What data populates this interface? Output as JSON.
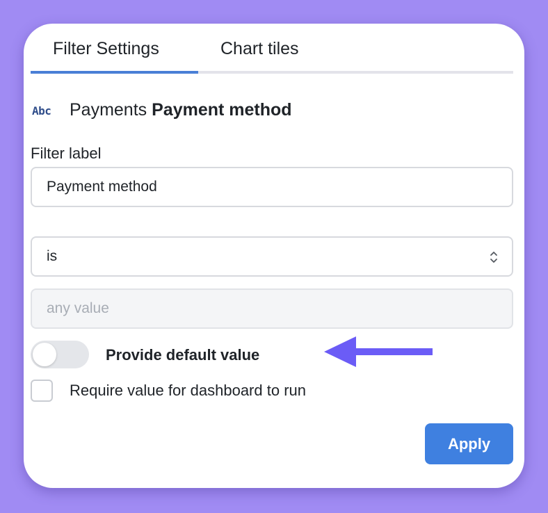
{
  "tabs": {
    "filter_settings": "Filter Settings",
    "chart_tiles": "Chart tiles",
    "active": "Filter Settings"
  },
  "field": {
    "icon": "abc-text-type-icon",
    "icon_text": "Abc",
    "table": "Payments",
    "name": "Payment method"
  },
  "filter_label": {
    "label": "Filter label",
    "value": "Payment method"
  },
  "operator": {
    "value": "is"
  },
  "value_input": {
    "placeholder": "any value"
  },
  "toggle": {
    "label": "Provide default value",
    "checked": false
  },
  "require": {
    "label": "Require value for dashboard to run",
    "checked": false
  },
  "apply_label": "Apply",
  "colors": {
    "background": "#a08bf3",
    "accent": "#3f80e0",
    "arrow": "#6b5cf6"
  }
}
